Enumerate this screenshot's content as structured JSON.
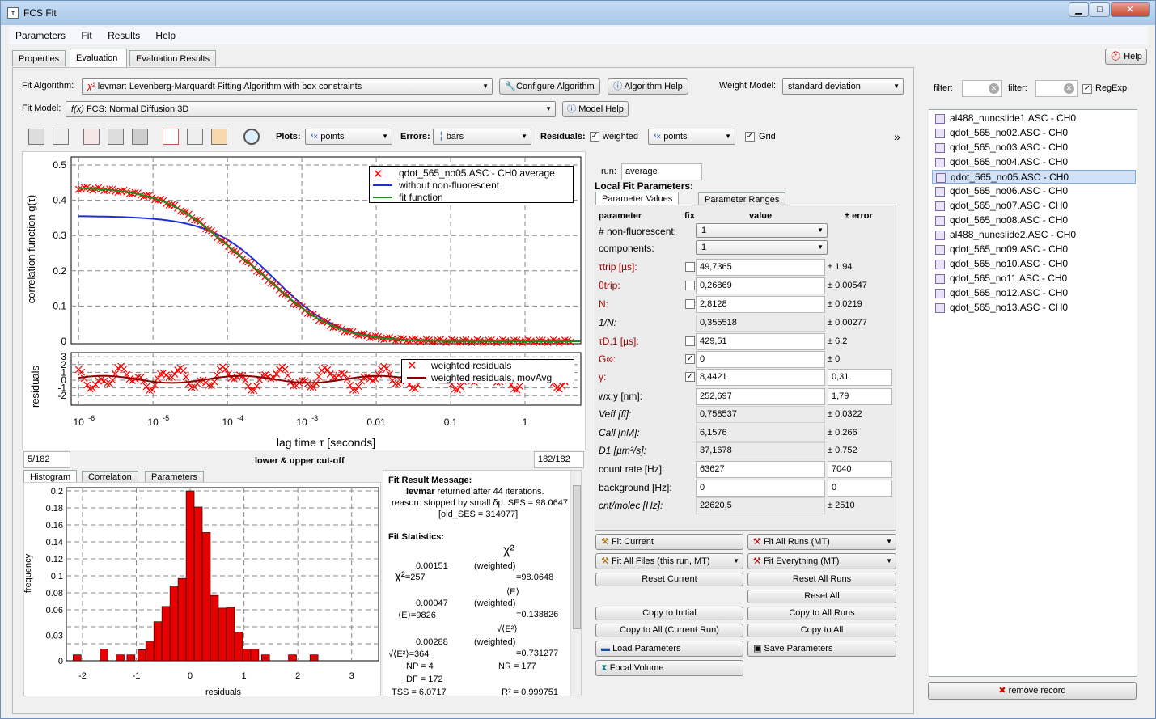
{
  "window": {
    "title": "FCS Fit",
    "min": "▁",
    "max": "□",
    "close": "✕"
  },
  "menu": [
    "Parameters",
    "Fit",
    "Results",
    "Help"
  ],
  "tabs": [
    "Properties",
    "Evaluation",
    "Evaluation Results"
  ],
  "help_button": "Help",
  "fit_algorithm": {
    "label": "Fit Algorithm:",
    "value": "levmar: Levenberg-Marquardt Fitting Algorithm with box constraints",
    "configure": "Configure Algorithm",
    "help": "Algorithm Help"
  },
  "weight_model": {
    "label": "Weight Model:",
    "value": "standard deviation"
  },
  "fit_model": {
    "label": "Fit Model:",
    "value": "FCS: Normal Diffusion 3D",
    "help": "Model Help"
  },
  "toolbar": {
    "plots_label": "Plots:",
    "plots_value": "points",
    "errors_label": "Errors:",
    "errors_value": "bars",
    "residuals_label": "Residuals:",
    "weighted": "weighted",
    "res_value": "points",
    "grid": "Grid",
    "more": "»"
  },
  "main_plot": {
    "ylabel": "correlation function g(τ)",
    "yticks": [
      "0.5",
      "0.4",
      "0.3",
      "0.2",
      "0.1",
      "0"
    ],
    "legend": [
      "qdot_565_no05.ASC - CH0 average",
      "without non-fluorescent",
      "fit function"
    ],
    "colors": {
      "data": "#ff0000",
      "nonfluor": "#1c2fd6",
      "fit": "#1f8a1f"
    }
  },
  "res_plot": {
    "ylabel": "residuals",
    "yticks": [
      "3",
      "2",
      "1",
      "0",
      "-1",
      "-2"
    ],
    "legend": [
      "weighted residuals",
      "weighted residuals, movAvg"
    ],
    "xticks": [
      "10",
      "10",
      "10",
      "10",
      "0.01",
      "0.1",
      "1"
    ],
    "xexp": [
      "-6",
      "-5",
      "-4",
      "-3"
    ],
    "xlabel": "lag time τ [seconds]"
  },
  "cutoff": {
    "low": "5/182",
    "high": "182/182",
    "label": "lower & upper cut-off"
  },
  "bottom_tabs": [
    "Histogram",
    "Correlation",
    "Parameters"
  ],
  "histogram": {
    "ylabel": "frequency",
    "xlabel": "residuals",
    "yticks": [
      "0.2",
      "0.18",
      "0.16",
      "0.14",
      "0.12",
      "0.1",
      "0.08",
      "0.06",
      "0.03",
      "0"
    ],
    "xticks": [
      "-2",
      "-1",
      "0",
      "1",
      "2",
      "3"
    ]
  },
  "chart_data": {
    "type": "bar",
    "xlabel": "residuals",
    "ylabel": "frequency",
    "bin_centers": [
      -2.1,
      -1.6,
      -1.3,
      -1.1,
      -0.9,
      -0.75,
      -0.6,
      -0.45,
      -0.3,
      -0.15,
      0,
      0.15,
      0.3,
      0.45,
      0.6,
      0.75,
      0.9,
      1.05,
      1.2,
      1.4,
      1.65,
      1.9,
      2.3,
      2.7
    ],
    "values": [
      0.007,
      0.014,
      0.007,
      0.007,
      0.013,
      0.023,
      0.046,
      0.064,
      0.088,
      0.097,
      0.2,
      0.181,
      0.151,
      0.077,
      0.062,
      0.063,
      0.034,
      0.014,
      0.014,
      0.007,
      0,
      0.007,
      0.007,
      0
    ],
    "xlim": [
      -2.3,
      3.5
    ],
    "ylim": [
      0,
      0.2
    ]
  },
  "fit_result": {
    "title": "Fit Result Message:",
    "line1_bold": "levmar",
    "line1": " returned after 44 iterations.",
    "line2": "reason: stopped by small δp. SES = 98.0647",
    "line3": "[old_SES = 314977]",
    "stats_title": "Fit Statistics:",
    "chi": "χ²",
    "chi_w": "(weighted)",
    "chi2_sup": "0.00151",
    "chi2_val": "=257",
    "chi2w_val": "=98.0648",
    "e_label": "⟨E⟩",
    "e_sup": "0.00047",
    "e_val": "=9826",
    "ew_val": "=0.138826",
    "rms_label": "√⟨E²⟩",
    "rms_sup": "0.00288",
    "rms_val": "=364",
    "rmsw_val": "=0.731277",
    "np": "NP = 4",
    "nr": "NR = 177",
    "df": "DF = 172",
    "tss": "TSS = 6.0717",
    "r2": "R² = 0.999751"
  },
  "run": {
    "label": "run:",
    "value": "average"
  },
  "local_fit": "Local Fit Parameters:",
  "param_tabs": [
    "Parameter Values",
    "Parameter Ranges"
  ],
  "param_headers": {
    "parameter": "parameter",
    "fix": "fix",
    "value": "value",
    "error": "± error"
  },
  "params": [
    {
      "name": "# non-fluorescent:",
      "kind": "combo",
      "value": "1"
    },
    {
      "name": "components:",
      "kind": "combo",
      "value": "1"
    },
    {
      "name": "τtrip [µs]:",
      "kind": "edit",
      "fix": false,
      "value": "49,7365",
      "error": "± 1.94",
      "red": true
    },
    {
      "name": "θtrip:",
      "kind": "edit",
      "fix": false,
      "value": "0,26869",
      "error": "± 0.00547",
      "red": true
    },
    {
      "name": "N:",
      "kind": "edit",
      "fix": false,
      "value": "2,8128",
      "error": "± 0.0219",
      "red": true
    },
    {
      "name": "1/N:",
      "kind": "ro",
      "value": "0,355518",
      "error": "± 0.00277",
      "italic": true
    },
    {
      "name": "τD,1 [µs]:",
      "kind": "edit",
      "fix": false,
      "value": "429,51",
      "error": "± 6.2",
      "red": true
    },
    {
      "name": "G∞:",
      "kind": "edit",
      "fix": true,
      "value": "0",
      "error": "± 0",
      "red": true
    },
    {
      "name": "γ:",
      "kind": "edit",
      "fix": true,
      "value": "8,4421",
      "error_edit": "0,31",
      "red": true
    },
    {
      "name": "wx,y [nm]:",
      "kind": "edit",
      "value": "252,697",
      "error_edit": "1,79"
    },
    {
      "name": "Veff [fl]:",
      "kind": "ro",
      "value": "0,758537",
      "error": "± 0.0322",
      "italic": true
    },
    {
      "name": "Call [nM]:",
      "kind": "ro",
      "value": "6,1576",
      "error": "± 0.266",
      "italic": true
    },
    {
      "name": "D1 [µm²/s]:",
      "kind": "ro",
      "value": "37,1678",
      "error": "± 0.752",
      "italic": true
    },
    {
      "name": "count rate [Hz]:",
      "kind": "edit",
      "value": "63627",
      "error_edit": "7040"
    },
    {
      "name": "background [Hz]:",
      "kind": "edit",
      "value": "0",
      "error_edit": "0"
    },
    {
      "name": "cnt/molec [Hz]:",
      "kind": "ro",
      "value": "22620,5",
      "error": "± 2510",
      "italic": true
    }
  ],
  "actions": {
    "fit_current": "Fit Current",
    "fit_all_runs": "Fit All Runs (MT)",
    "fit_all_files": "Fit All Files (this run, MT)",
    "fit_everything": "Fit Everything (MT)",
    "reset_current": "Reset Current",
    "reset_all_runs": "Reset All Runs",
    "reset_all": "Reset All",
    "copy_initial": "Copy to Initial",
    "copy_all_runs": "Copy to All Runs",
    "copy_all_current": "Copy to All (Current Run)",
    "copy_all": "Copy to All",
    "load_params": "Load Parameters",
    "save_params": "Save Parameters",
    "focal_volume": "Focal Volume"
  },
  "filter": {
    "label1": "filter:",
    "label2": "filter:",
    "regexp": "RegExp"
  },
  "files": [
    "al488_nuncslide1.ASC - CH0",
    "qdot_565_no02.ASC - CH0",
    "qdot_565_no03.ASC - CH0",
    "qdot_565_no04.ASC - CH0",
    "qdot_565_no05.ASC - CH0",
    "qdot_565_no06.ASC - CH0",
    "qdot_565_no07.ASC - CH0",
    "qdot_565_no08.ASC - CH0",
    "al488_nuncslide2.ASC - CH0",
    "qdot_565_no09.ASC - CH0",
    "qdot_565_no10.ASC - CH0",
    "qdot_565_no11.ASC - CH0",
    "qdot_565_no12.ASC - CH0",
    "qdot_565_no13.ASC - CH0"
  ],
  "selected_file": 4,
  "remove_record": "remove record"
}
